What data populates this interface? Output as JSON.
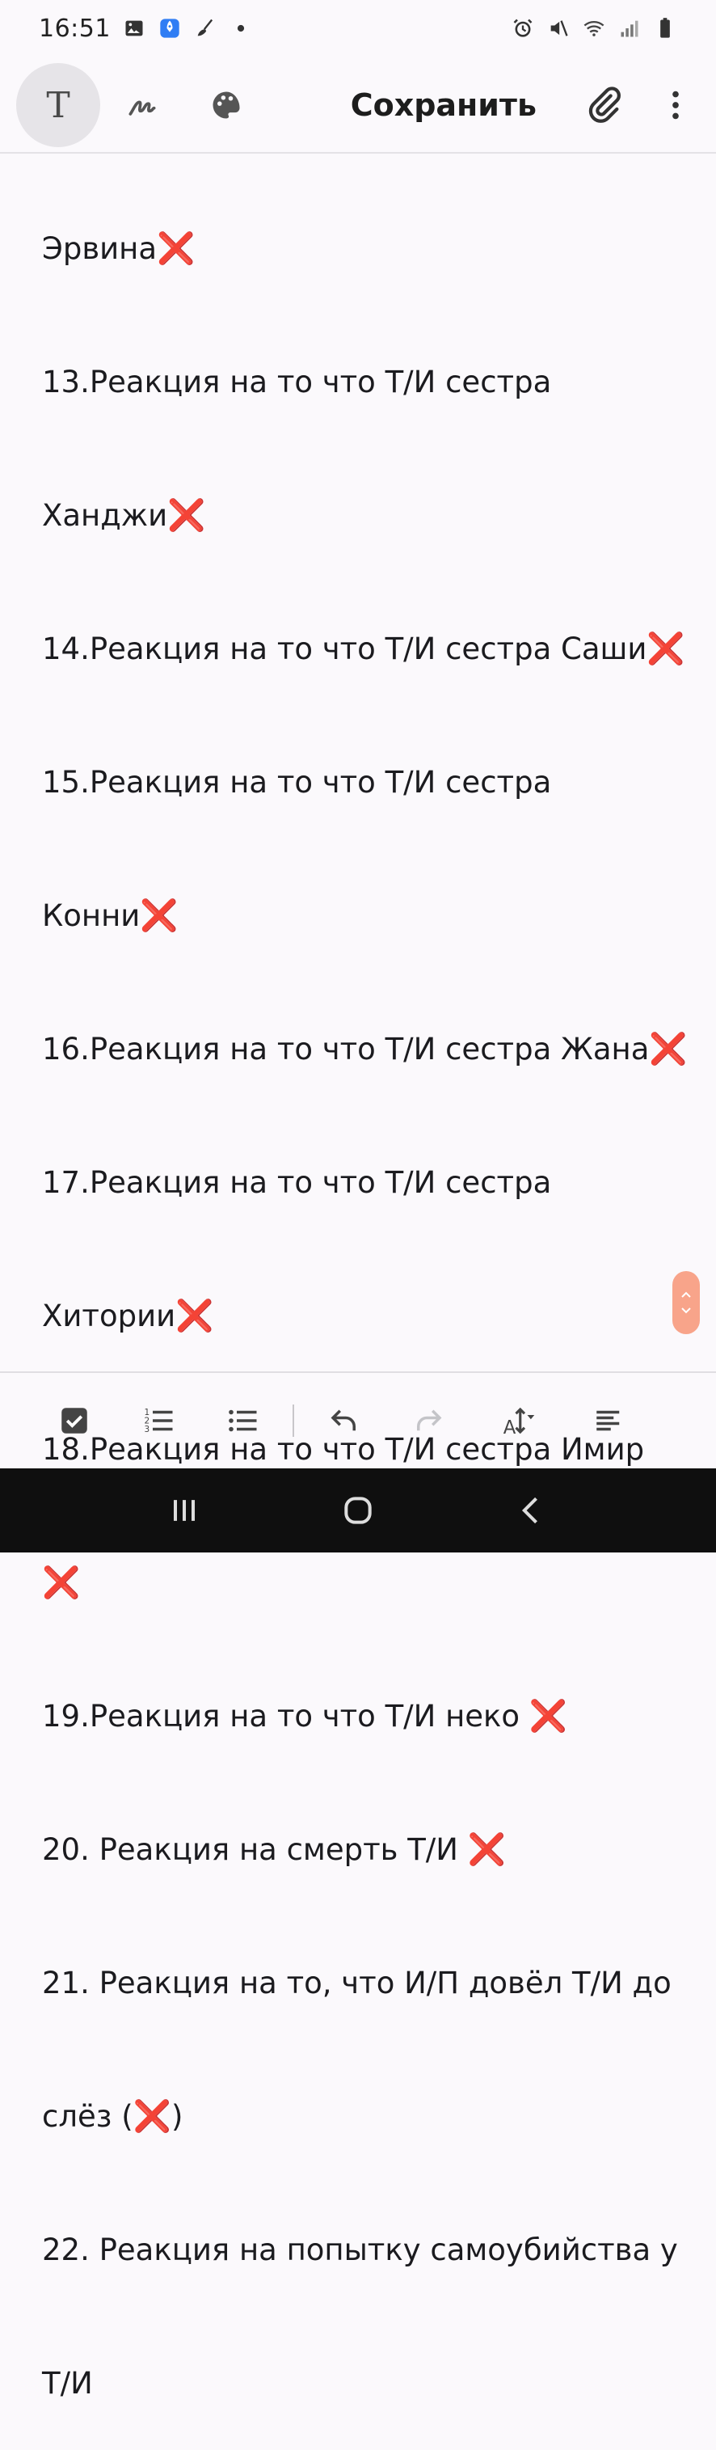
{
  "status_bar": {
    "time": "16:51",
    "left_icons": [
      "gallery-icon",
      "rocket-app-icon",
      "broom-icon",
      "dot-icon"
    ],
    "right_icons": [
      "alarm-icon",
      "mute-icon",
      "wifi-icon",
      "signal-icon",
      "battery-icon"
    ]
  },
  "toolbar": {
    "text_mode_glyph": "T",
    "save_label": "Сохранить",
    "icons": [
      "text-icon",
      "pen-icon",
      "palette-icon",
      "attach-icon",
      "more-icon"
    ]
  },
  "note": {
    "lines": [
      {
        "text": "Эрвина",
        "mark": "❌"
      },
      {
        "text": "13.Реакция на то что Т/И сестра",
        "mark": ""
      },
      {
        "text": "Ханджи",
        "mark": "❌"
      },
      {
        "text": "14.Реакция на то что Т/И сестра Саши",
        "mark": "❌"
      },
      {
        "text": "15.Реакция на то что Т/И сестра",
        "mark": ""
      },
      {
        "text": "Конни",
        "mark": "❌"
      },
      {
        "text": "16.Реакция на то что Т/И сестра Жана",
        "mark": "❌"
      },
      {
        "text": "17.Реакция на то что Т/И сестра",
        "mark": ""
      },
      {
        "text": "Хитории",
        "mark": "❌"
      },
      {
        "text": "18.Реакция на то что Т/И сестра Имир",
        "mark": ""
      },
      {
        "text": "",
        "mark": "❌"
      },
      {
        "text": "19.Реакция на то что Т/И неко ",
        "mark": "❌"
      },
      {
        "text": "20. Реакция на смерть Т/И ",
        "mark": "❌"
      },
      {
        "text": "21. Реакция на то, что И/П довёл Т/И до",
        "mark": ""
      },
      {
        "text": "слёз (",
        "mark": "❌",
        "after": ")"
      },
      {
        "text": "22. Реакция на попытку самоубийства у",
        "mark": ""
      },
      {
        "text": "Т/И",
        "mark": ""
      }
    ]
  },
  "format_bar": {
    "icons": [
      "checkbox-icon",
      "numbered-list-icon",
      "bullet-list-icon",
      "undo-icon",
      "redo-icon",
      "text-size-icon",
      "align-icon"
    ]
  },
  "colors": {
    "accent_scroll": "#f8a48a",
    "x_mark": "#e0282f",
    "background": "#fbf9fc"
  }
}
